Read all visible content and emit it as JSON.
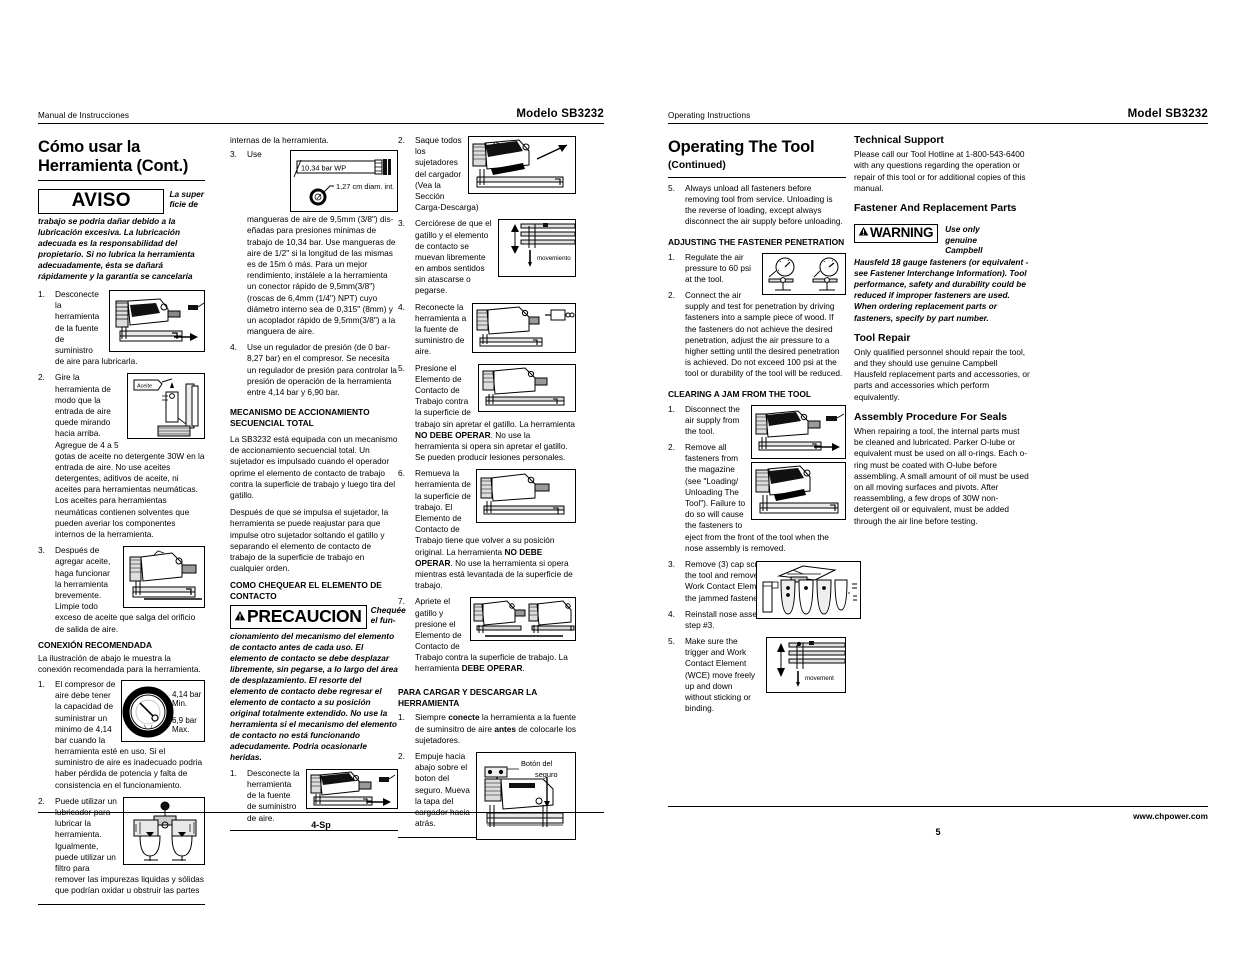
{
  "left_page": {
    "header": {
      "left": "Manual de Instrucciones",
      "right": "Modelo SB3232"
    },
    "title": "Cómo usar la Herramienta (Cont.)",
    "notice": {
      "label": "AVISO",
      "lead": "La super ficie de",
      "body": "trabajo se podria dañar debido a la lubricación excesiva. La lubricación adecuada es la responsabilidad del propietario. Si no lubrica la herramienta adecuadamente, ésta se dañará rápidamente y la garantía se cancelaría"
    },
    "col1_steps": [
      {
        "n": "1.",
        "text": "Desconecte la herramienta de la fuente de suministro de aire para lubricarla."
      },
      {
        "n": "2.",
        "text": "Gire la herramienta de modo que la entrada de aire quede mirando hacia arriba. Agregue de 4 a 5 gotas de aceite no detergente 30W en la entrada de aire. No use aceites detergentes, aditivos de aceite, ni aceites para herramientas neumáticas. Los aceites para herramientas neumáticas contienen solventes que pueden averiar los componentes internos de la herramienta."
      },
      {
        "n": "3.",
        "text": "Después de agregar aceite, haga funcionar la herramienta brevemente. Limpie todo exceso de aceite que salga del orificio de salida de aire."
      }
    ],
    "conexion": {
      "heading": "CONEXIÓN RECOMENDADA",
      "intro": "La ilustración de abajo le muestra la conexión recomendada para la herramienta.",
      "steps": [
        {
          "n": "1.",
          "text": "El compresor de aire debe tener la capacidad de suministrar un minimo de 4,14 bar cuando la herramienta esté en uso. Si el suministro de aire es inadecuado podria haber pérdida de potencia y falta de consistencia en el funcionamiento."
        },
        {
          "n": "2.",
          "text": "Puede utilizar un lubricador para lubricar la herramienta. Igualmente, puede utilizar un filtro para remover las impurezas liquidas y sólidas que podrían oxidar u obstruir las partes"
        }
      ]
    },
    "gauge_labels": {
      "min": "4,14 bar Min.",
      "max": "6,9 bar Max."
    },
    "oil_label": "Aceite",
    "col2": {
      "cont_line": "internas de la herramienta.",
      "step3": {
        "n": "3.",
        "text_pre": "Use mangueras de aire de 9,5mm (3/8\") dis-",
        "text_post": "eñadas para presiones minimas de trabajo de 10,34 bar. Use mangueras de aire de 1/2\" si la longitud de las mismas es de 15m ó más. Para un mejor rendimiento, instálele a la herramienta un conector rápido de 9,5mm(3/8\") (roscas de 6,4mm (1/4\") NPT) cuyo diámetro interno sea de 0,315\" (8mm) y un acoplador rápido de 9,5mm(3/8\") a la manguera de aire."
      },
      "hose_fig": {
        "label_wp": "10,34 bar WP",
        "label_diam": "1,27 cm diam. int."
      },
      "step4": {
        "n": "4.",
        "text": "Use un regulador de presión (de 0 bar-8,27 bar) en el compresor. Se necesita un regulador de presión para controlar la presión de operación de la herramienta entre 4,14 bar y 6,90 bar."
      },
      "mech_heading": "MECANISMO DE ACCIONAMIENTO SECUENCIAL TOTAL",
      "mech_p1": "La SB3232 está equipada con un mecanismo de accionamiento secuencial total. Un sujetador es impulsado cuando el operador oprime el elemento de contacto de trabajo contra la superficie de trabajo y luego tira del gatillo.",
      "mech_p2": "Después de que se impulsa el sujetador, la herramienta se puede reajustar para que impulse otro sujetador soltando el gatillo y separando el elemento de contacto de trabajo de la superficie de trabajo en cualquier orden.",
      "check_heading": "COMO CHEQUEAR EL ELEMENTO DE CONTACTO",
      "caution": {
        "label": "PRECAUCION",
        "lead": "Chequée el fun-",
        "body": "cionamiento del mecanismo del elemento de contacto antes de cada uso. El elemento de contacto se debe desplazar libremente, sin pegarse, a lo largo del área de desplazamiento. El resorte del elemento de contacto debe regresar el elemento de contacto a su posición original totalmente extendido. No use la herramienta si el mecanismo del elemento de contacto no está funcionando adecudamente. Podria ocasionarle heridas."
      },
      "caution_step1": {
        "n": "1.",
        "text": "Desconecte la herramienta de la fuente de suministro de aire."
      }
    },
    "col3": {
      "steps": [
        {
          "n": "2.",
          "text": "Saque todos los sujetadores del cargador (Vea la Sección Carga-Descarga)"
        },
        {
          "n": "3.",
          "text": "Cerciórese de que el gatillo y el elemento de contacto se muevan libremente en ambos sentidos sin atascarse o pegarse."
        },
        {
          "n": "4.",
          "text": "Reconecte la herramienta a la fuente de suministro de aire."
        },
        {
          "n": "5.",
          "text_a": "Presione el Elemento de Contacto de Trabajo contra la superficie de trabajo sin apretar el gatillo. La herramienta ",
          "bold_a": "NO DEBE OPERAR",
          "text_b": ". No use la herramienta si opera sin apretar el gatillo. Se pueden producir lesiones personales."
        },
        {
          "n": "6.",
          "text_a": "Remueva la herramienta de la superficie de trabajo. El Elemento de Contacto de Trabajo tiene que volver a su posición original. La herramienta ",
          "bold_a": "NO DEBE OPERAR",
          "text_b": ". No use la herramienta si opera mientras está levantada de la superficie de trabajo."
        },
        {
          "n": "7.",
          "text_a": "Apriete el gatillo y presione el Elemento de Contacto de Trabajo contra la superficie de trabajo. La herramienta ",
          "bold_a": "DEBE OPERAR",
          "text_b": "."
        }
      ],
      "load_heading": "PARA CARGAR Y DESCARGAR LA HERRAMIENTA",
      "load_steps": [
        {
          "n": "1.",
          "text_a": "Siempre ",
          "bold_a": "conecte",
          "text_b": " la herramienta a la fuente de suminsitro de aire ",
          "bold_b": "antes",
          "text_c": " de colocarle los sujetadores."
        },
        {
          "n": "2.",
          "text": "Empuje hacia abajo sobre el boton del seguro. Mueva la tapa del cargador hacia atrás."
        }
      ],
      "lock_label": "Botón del seguro",
      "movement_label": "movemiento"
    },
    "footer": {
      "page": "4-Sp"
    }
  },
  "right_page": {
    "header": {
      "left": "Operating Instructions",
      "right": "Model SB3232"
    },
    "title": "Operating The Tool",
    "subtitle": "(Continued)",
    "col1": {
      "step5": {
        "n": "5.",
        "text": "Always unload all fasteners before removing tool from service. Unloading is the reverse of loading, except always disconnect the air supply before unloading."
      },
      "adjust_heading": "ADJUSTING THE FASTENER PENETRATION",
      "adjust_steps": [
        {
          "n": "1.",
          "text": "Regulate the air pressure to 60 psi at the tool."
        },
        {
          "n": "2.",
          "text": "Connect the air supply and test for penetration by driving fasteners into a sample piece of wood.  If the fasteners do not achieve the desired penetration, adjust the air pressure to a higher setting until the desired penetration is achieved.  Do not exceed 100 psi at the tool or durability of the tool will be reduced."
        }
      ],
      "jam_heading": "CLEARING A JAM FROM THE TOOL",
      "jam_steps": [
        {
          "n": "1.",
          "text": "Disconnect the air supply from the tool."
        },
        {
          "n": "2.",
          "text": "Remove all fasteners from the magazine (see \"Loading/ Unloading The Tool\").  Failure to do so will cause the fasteners to eject from the front of the tool when the nose assembly is removed."
        },
        {
          "n": "3.",
          "text": "Remove (3) cap screws from the nose of the tool and remove the plate, spacer and Work Contact Element (WCE) to expose the jammed fastener."
        },
        {
          "n": "4.",
          "text": "Reinstall nose assembly in reverse order in step #3."
        },
        {
          "n": "5.",
          "text": "Make sure the trigger and Work Contact Element (WCE) move freely up and down without sticking or binding."
        }
      ],
      "movement_label": "movement"
    },
    "col2": {
      "tech_heading": "Technical Support",
      "tech_body": "Please call our Tool Hotline at 1-800-543-6400 with any questions regarding the operation or repair of this tool or for additional copies of this manual.",
      "fastener_heading": "Fastener And Replacement Parts",
      "warning": {
        "label": "WARNING",
        "lead": "Use only genuine Campbell",
        "body": "Hausfeld 18 gauge fasteners (or equivalent - see Fastener Interchange Information). Tool performance, safety and durability could be reduced if improper fasteners are used. When ordering replacement parts or fasteners, specify by part number."
      },
      "repair_heading": "Tool Repair",
      "repair_body": "Only qualified personnel should repair the tool, and they should use genuine Campbell Hausfeld replacement parts and accessories, or parts and accessories which perform equivalently.",
      "seals_heading": "Assembly Procedure For Seals",
      "seals_body": "When repairing a tool, the internal parts must be cleaned and lubricated. Parker O-lube or equivalent must be used on all o-rings. Each o-ring must be coated with O-lube before assembling. A small amount of oil must be used on all moving surfaces and pivots. After reassembling, a few drops of 30W non-detergent oil or equivalent, must be added through the air line before testing."
    },
    "footer": {
      "page": "5",
      "site": "www.chpower.com"
    }
  }
}
